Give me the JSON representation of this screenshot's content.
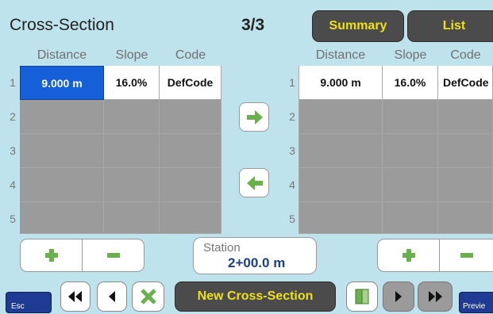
{
  "header": {
    "title": "Cross-Section",
    "page": "3/3",
    "summary_label": "Summary",
    "list_label": "List"
  },
  "columns": [
    "Distance",
    "Slope",
    "Code"
  ],
  "row_numbers": [
    "1",
    "2",
    "3",
    "4",
    "5"
  ],
  "left_table": {
    "rows": [
      {
        "distance": "9.000 m",
        "slope": "16.0%",
        "code": "DefCode"
      },
      {
        "distance": "",
        "slope": "",
        "code": ""
      },
      {
        "distance": "",
        "slope": "",
        "code": ""
      },
      {
        "distance": "",
        "slope": "",
        "code": ""
      },
      {
        "distance": "",
        "slope": "",
        "code": ""
      }
    ]
  },
  "right_table": {
    "rows": [
      {
        "distance": "9.000 m",
        "slope": "16.0%",
        "code": "DefCode"
      },
      {
        "distance": "",
        "slope": "",
        "code": ""
      },
      {
        "distance": "",
        "slope": "",
        "code": ""
      },
      {
        "distance": "",
        "slope": "",
        "code": ""
      },
      {
        "distance": "",
        "slope": "",
        "code": ""
      }
    ]
  },
  "station": {
    "label": "Station",
    "value": "2+00.0 m"
  },
  "footer": {
    "esc_label": "Esc",
    "new_cross_section_label": "New Cross-Section",
    "preview_label": "Previe"
  },
  "icons": {
    "arrow_right": "arrow-right-icon",
    "arrow_left": "arrow-left-icon",
    "first": "double-left-icon",
    "prev": "left-triangle-icon",
    "cancel": "x-icon",
    "split": "split-view-icon",
    "next": "right-triangle-icon",
    "last": "double-right-icon"
  },
  "colors": {
    "accent_yellow": "#f0e018",
    "selected_blue": "#1560d8",
    "arrow_green": "#6ab04c",
    "background": "#bfe3ec"
  }
}
